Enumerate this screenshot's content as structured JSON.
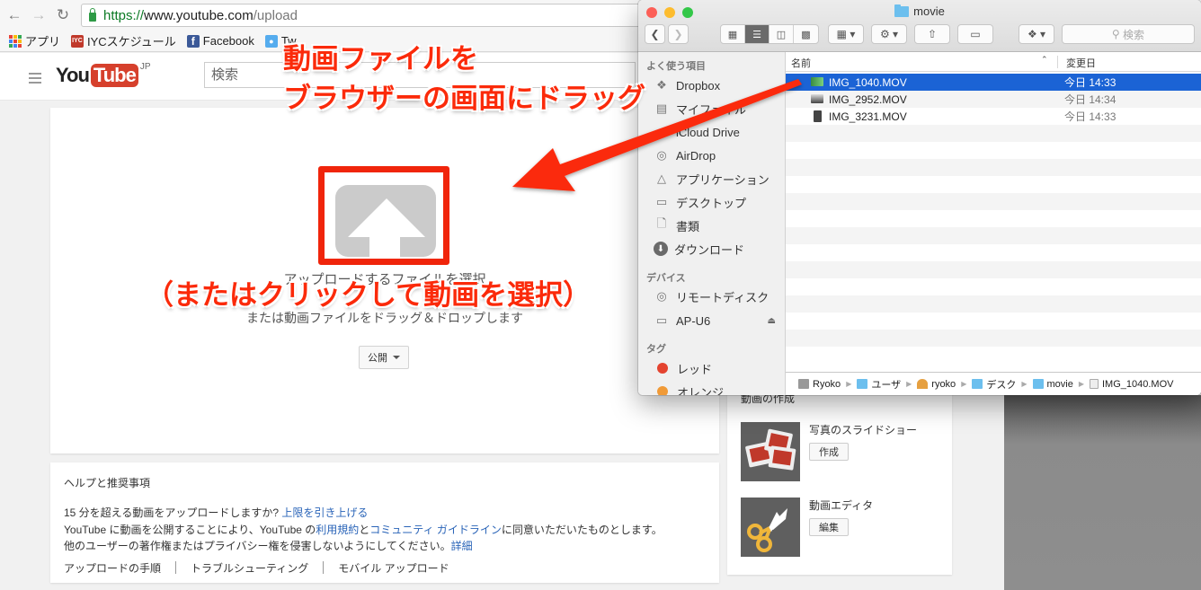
{
  "browser": {
    "url_scheme": "https://",
    "url_host": "www.youtube.com",
    "url_path": "/upload",
    "bookmarks": [
      {
        "label": "アプリ",
        "icon": "apps-grid-icon"
      },
      {
        "label": "IYCスケジュール",
        "icon": "iyc-icon",
        "icon_text": "IYC"
      },
      {
        "label": "Facebook",
        "icon": "facebook-icon",
        "icon_text": "f"
      },
      {
        "label": "Tw",
        "icon": "twitter-icon"
      }
    ]
  },
  "youtube": {
    "logo_you": "You",
    "logo_tube": "Tube",
    "logo_region": "JP",
    "search_placeholder": "検索",
    "upload": {
      "select_label": "アップロードするファイルを選択",
      "drag_label": "または動画ファイルをドラッグ＆ドロップします",
      "privacy_value": "公開"
    },
    "help": {
      "title": "ヘルプと推奨事項",
      "line1_text": "15 分を超える動画をアップロードしますか? ",
      "line1_link": "上限を引き上げる",
      "line2_a": "YouTube に動画を公開することにより、YouTube の",
      "line2_link1": "利用規約",
      "line2_b": "と",
      "line2_link2": "コミュニティ ガイドライン",
      "line2_c": "に同意いただいたものとします。",
      "line3_text": "他のユーザーの著作権またはプライバシー権を侵害しないようにしてください。",
      "line3_link": "詳細",
      "footer_links": [
        "アップロードの手順",
        "トラブルシューティング",
        "モバイル アップロード"
      ]
    },
    "create": {
      "title": "動画の作成",
      "items": [
        {
          "name": "写真のスライドショー",
          "button": "作成",
          "icon": "slideshow-icon"
        },
        {
          "name": "動画エディタ",
          "button": "編集",
          "icon": "scissors-icon"
        }
      ]
    }
  },
  "finder": {
    "title": "movie",
    "search_placeholder": "検索",
    "sidebar": {
      "favorites_header": "よく使う項目",
      "favorites": [
        {
          "label": "Dropbox",
          "icon": "dropbox-icon"
        },
        {
          "label": "マイファイル",
          "icon": "all-files-icon"
        },
        {
          "label": "iCloud Drive",
          "icon": "icloud-icon"
        },
        {
          "label": "AirDrop",
          "icon": "airdrop-icon"
        },
        {
          "label": "アプリケーション",
          "icon": "applications-icon"
        },
        {
          "label": "デスクトップ",
          "icon": "desktop-icon"
        },
        {
          "label": "書類",
          "icon": "documents-icon"
        },
        {
          "label": "ダウンロード",
          "icon": "downloads-icon"
        }
      ],
      "devices_header": "デバイス",
      "devices": [
        {
          "label": "リモートディスク",
          "icon": "remote-disc-icon"
        },
        {
          "label": "AP-U6",
          "icon": "drive-icon",
          "ejectable": true
        }
      ],
      "tags_header": "タグ",
      "tags": [
        {
          "label": "レッド",
          "color": "#e4432f"
        },
        {
          "label": "オレンジ",
          "color": "#f09a37"
        }
      ]
    },
    "columns": {
      "name": "名前",
      "date": "変更日"
    },
    "files": [
      {
        "name": "IMG_1040.MOV",
        "date": "今日 14:33",
        "selected": true
      },
      {
        "name": "IMG_2952.MOV",
        "date": "今日 14:34",
        "selected": false
      },
      {
        "name": "IMG_3231.MOV",
        "date": "今日 14:33",
        "selected": false
      }
    ],
    "path": [
      "Ryoko",
      "ユーザ",
      "ryoko",
      "デスク",
      "movie",
      "IMG_1040.MOV"
    ]
  },
  "annotations": {
    "line1": "動画ファイルを",
    "line2": "ブラウザーの画面にドラッグ",
    "line3": "（またはクリックして動画を選択）",
    "color": "#fb2a0a"
  }
}
